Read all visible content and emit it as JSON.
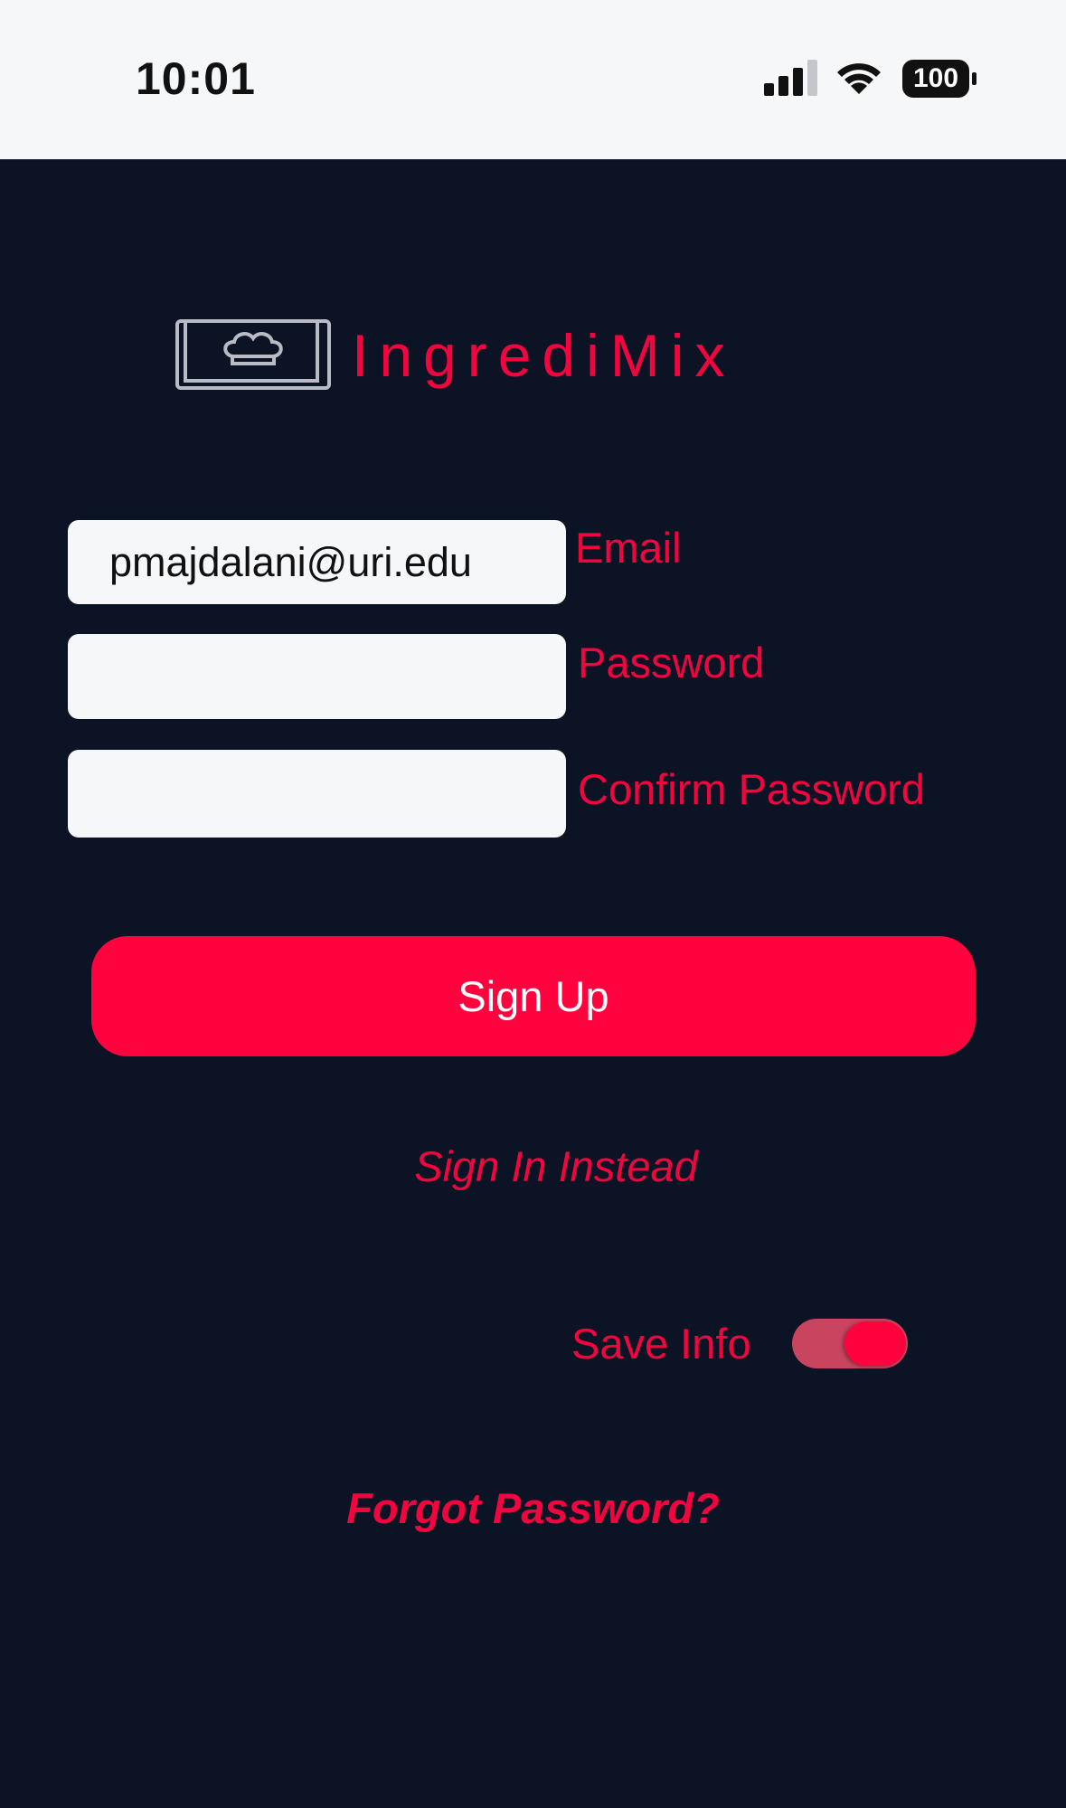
{
  "status_bar": {
    "time": "10:01",
    "battery": "100"
  },
  "logo": {
    "text": "IngrediMix"
  },
  "form": {
    "email_value": "pmajdalani@uri.edu",
    "email_label": "Email",
    "password_value": "",
    "password_label": "Password",
    "confirm_value": "",
    "confirm_label": "Confirm Password"
  },
  "actions": {
    "signup_label": "Sign Up",
    "signin_label": "Sign In Instead",
    "save_info_label": "Save Info",
    "save_info_on": true,
    "forgot_label": "Forgot Password?"
  },
  "colors": {
    "background": "#0b1324",
    "accent": "#fe033d",
    "label": "#f2053f",
    "field": "#f6f7f9"
  },
  "icons": [
    "signal-icon",
    "wifi-icon",
    "battery-icon",
    "chef-book-icon"
  ]
}
